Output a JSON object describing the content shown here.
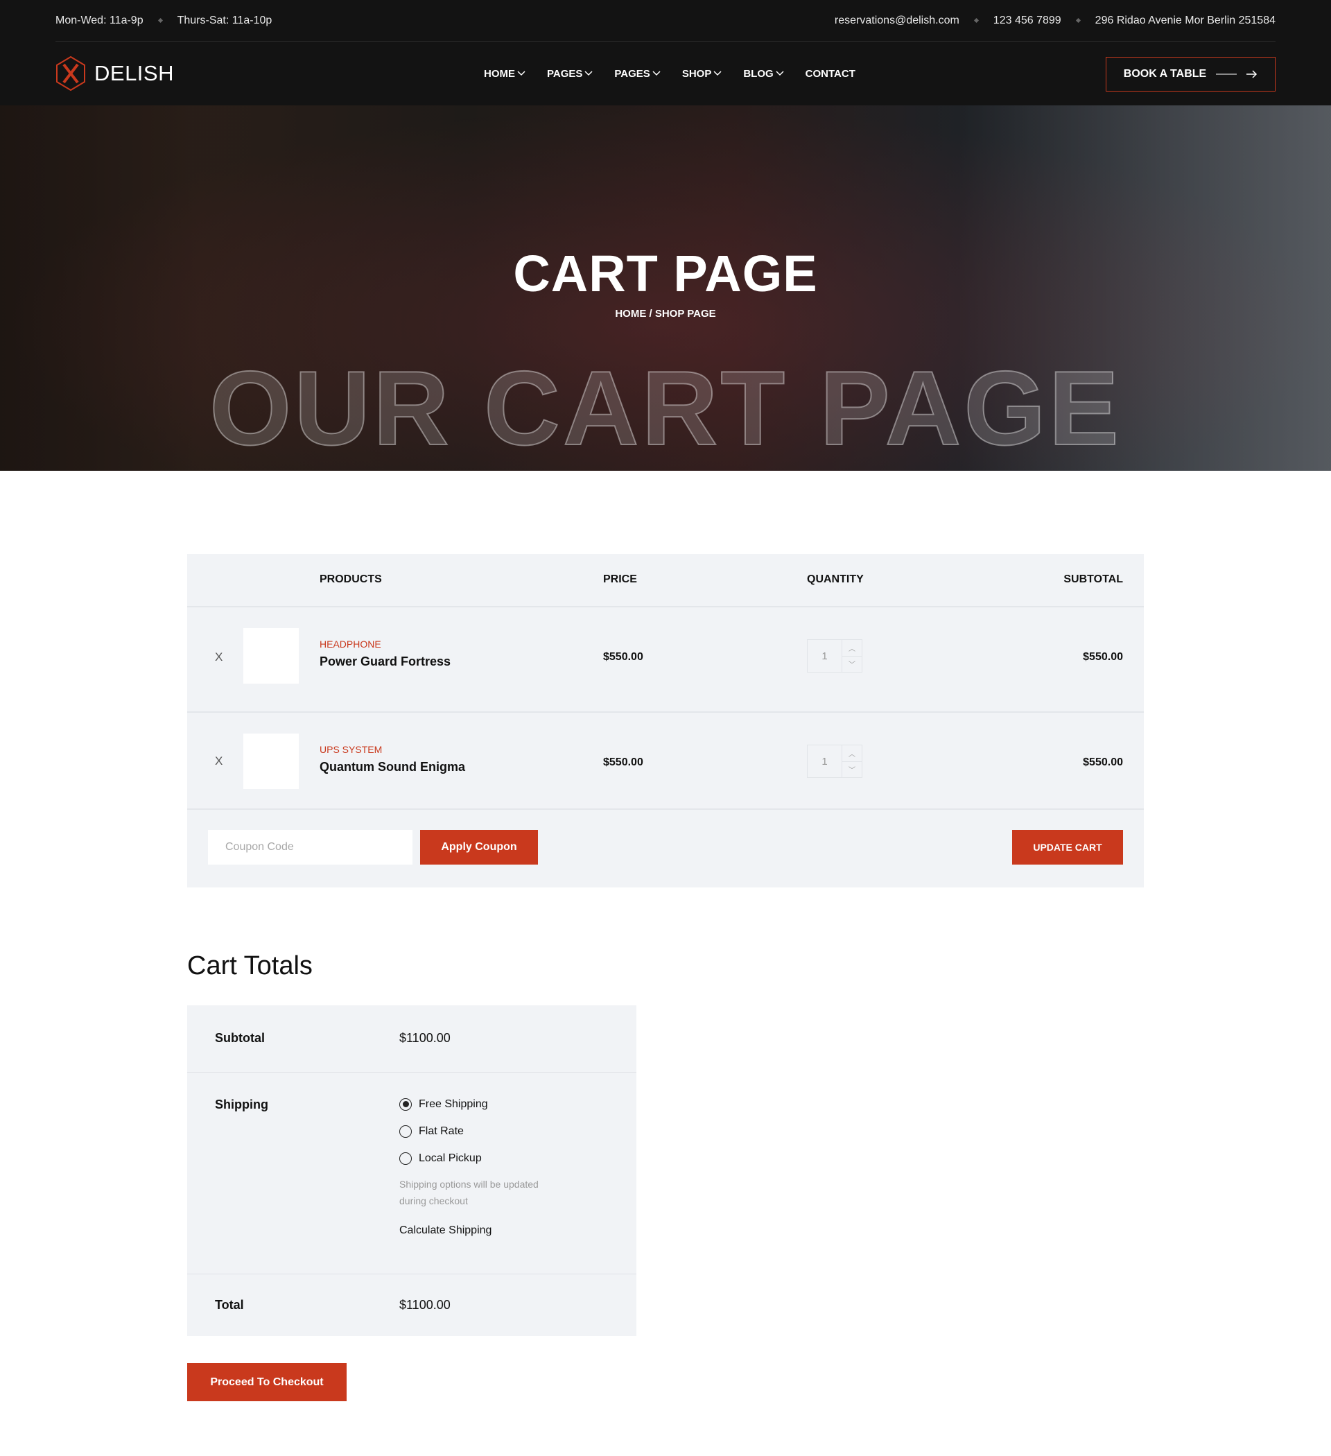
{
  "topbar": {
    "hours1": "Mon-Wed: 11a-9p",
    "hours2": "Thurs-Sat: 11a-10p",
    "email": "reservations@delish.com",
    "phone": "123 456 7899",
    "address": "296 Ridao Avenie Mor Berlin 251584"
  },
  "nav": {
    "logo": "DELISH",
    "items": [
      {
        "label": "HOME"
      },
      {
        "label": "PAGES"
      },
      {
        "label": "PAGES"
      },
      {
        "label": "SHOP"
      },
      {
        "label": "BLOG"
      },
      {
        "label": "CONTACT"
      }
    ],
    "book": "BOOK A TABLE"
  },
  "hero": {
    "title": "CART PAGE",
    "breadcrumb": "HOME / SHOP PAGE",
    "outline": "OUR CART PAGE"
  },
  "cart": {
    "headers": {
      "products": "PRODUCTS",
      "price": "PRICE",
      "quantity": "QUANTITY",
      "subtotal": "SUBTOTAL"
    },
    "items": [
      {
        "remove": "X",
        "category": "HEADPHONE",
        "name": "Power Guard Fortress",
        "price": "$550.00",
        "qty": "1",
        "subtotal": "$550.00"
      },
      {
        "remove": "X",
        "category": "UPS SYSTEM",
        "name": "Quantum Sound Enigma",
        "price": "$550.00",
        "qty": "1",
        "subtotal": "$550.00"
      }
    ],
    "coupon_placeholder": "Coupon Code",
    "apply": "Apply Coupon",
    "update": "UPDATE CART"
  },
  "totals": {
    "title": "Cart Totals",
    "subtotal_label": "Subtotal",
    "subtotal": "$1100.00",
    "shipping_label": "Shipping",
    "options": [
      {
        "label": "Free Shipping",
        "selected": true
      },
      {
        "label": "Flat Rate",
        "selected": false
      },
      {
        "label": "Local Pickup",
        "selected": false
      }
    ],
    "note1": "Shipping options will be updated",
    "note2": "during checkout",
    "calculate": "Calculate Shipping",
    "total_label": "Total",
    "total": "$1100.00",
    "checkout": "Proceed To Checkout"
  },
  "colors": {
    "accent": "#c9391d",
    "dark": "#131313",
    "panel": "#f1f3f6"
  }
}
